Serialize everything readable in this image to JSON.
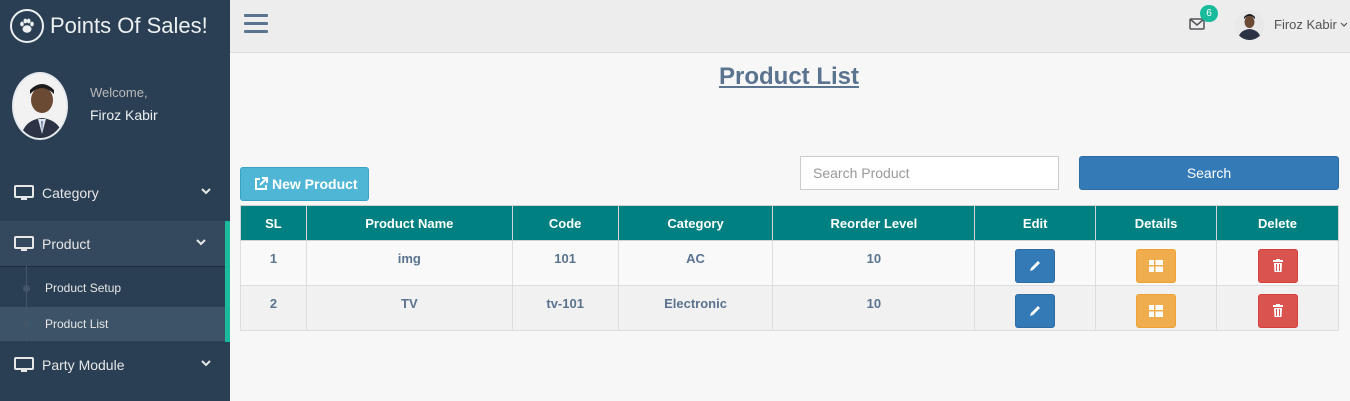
{
  "app": {
    "title": "Points Of Sales!"
  },
  "profile": {
    "welcome": "Welcome,",
    "name": "Firoz Kabir"
  },
  "sidebar": {
    "items": [
      {
        "label": "Category"
      },
      {
        "label": "Product"
      },
      {
        "label": "Party Module"
      }
    ],
    "submenu": [
      {
        "label": "Product Setup"
      },
      {
        "label": "Product List"
      }
    ]
  },
  "topnav": {
    "mail_count": "6",
    "user_name": "Firoz Kabir"
  },
  "page": {
    "title": "Product List"
  },
  "toolbar": {
    "new_label": "New Product",
    "search_placeholder": "Search Product",
    "search_label": "Search"
  },
  "table": {
    "headers": [
      "SL",
      "Product Name",
      "Code",
      "Category",
      "Reorder Level",
      "Edit",
      "Details",
      "Delete"
    ],
    "rows": [
      {
        "sl": "1",
        "name": "img",
        "code": "101",
        "category": "AC",
        "reorder": "10"
      },
      {
        "sl": "2",
        "name": "TV",
        "code": "tv-101",
        "category": "Electronic",
        "reorder": "10"
      }
    ]
  },
  "colors": {
    "sidebar": "#2a3f54",
    "accent": "#1abb9c",
    "table_header": "#008080",
    "edit": "#337ab7",
    "details": "#f0ad4e",
    "delete": "#d9534f"
  }
}
